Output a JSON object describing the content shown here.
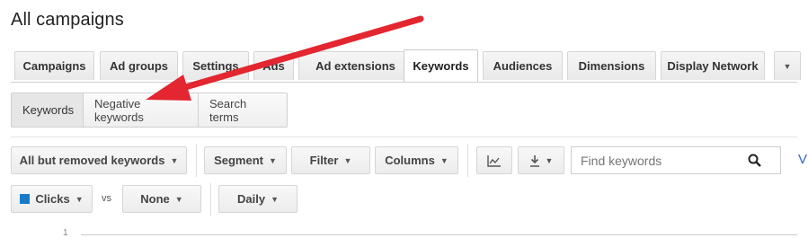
{
  "page": {
    "title": "All campaigns"
  },
  "tabs": [
    {
      "label": "Campaigns"
    },
    {
      "label": "Ad groups"
    },
    {
      "label": "Settings"
    },
    {
      "label": "Ads"
    },
    {
      "label": "Ad extensions"
    },
    {
      "label": "Keywords",
      "active": true
    },
    {
      "label": "Audiences"
    },
    {
      "label": "Dimensions"
    },
    {
      "label": "Display Network"
    }
  ],
  "subtabs": [
    {
      "label": "Keywords",
      "active": true
    },
    {
      "label": "Negative keywords"
    },
    {
      "label": "Search terms"
    }
  ],
  "toolbar": {
    "filter_status": "All but removed keywords",
    "segment": "Segment",
    "filter": "Filter",
    "columns": "Columns",
    "search_placeholder": "Find keywords",
    "cut_link": "V"
  },
  "graph_controls": {
    "metric1": "Clicks",
    "metric1_color": "#1a7ac8",
    "vs": "vs",
    "metric2": "None",
    "period": "Daily"
  },
  "graph": {
    "y_tick": "1"
  },
  "annotation": {
    "arrow_color": "#e3262f"
  }
}
